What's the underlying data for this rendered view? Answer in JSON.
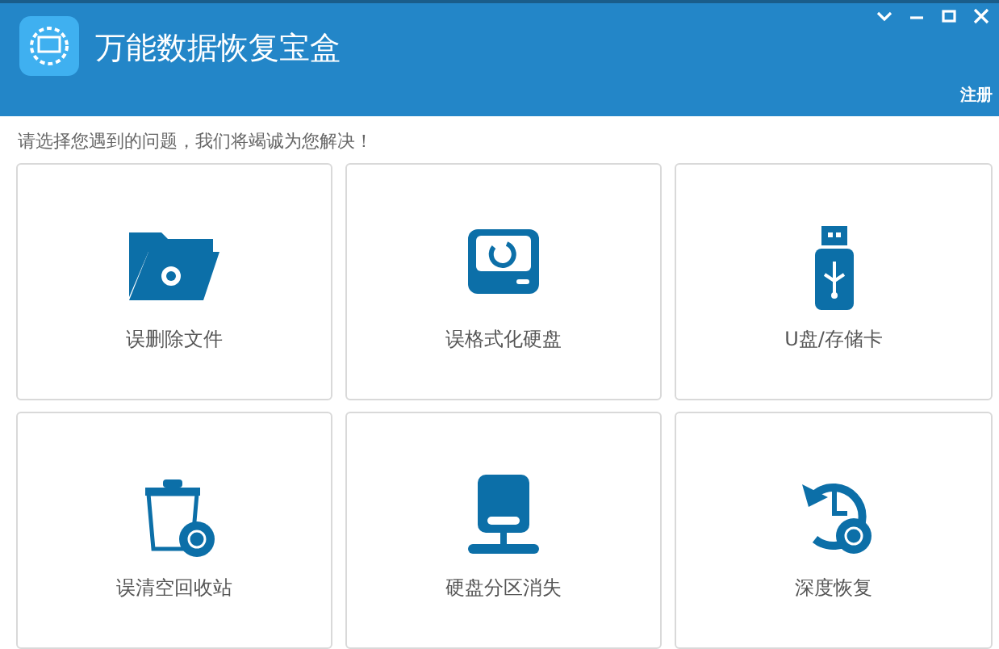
{
  "window": {
    "title": "万能数据恢复宝盒",
    "register": "注册"
  },
  "prompt": "请选择您遇到的问题，我们将竭诚为您解决！",
  "options": [
    {
      "kind": "folder",
      "label": "误删除文件"
    },
    {
      "kind": "disk",
      "label": "误格式化硬盘"
    },
    {
      "kind": "usb",
      "label": "U盘/存储卡"
    },
    {
      "kind": "bin",
      "label": "误清空回收站"
    },
    {
      "kind": "partition",
      "label": "硬盘分区消失"
    },
    {
      "kind": "history",
      "label": "深度恢复"
    }
  ]
}
